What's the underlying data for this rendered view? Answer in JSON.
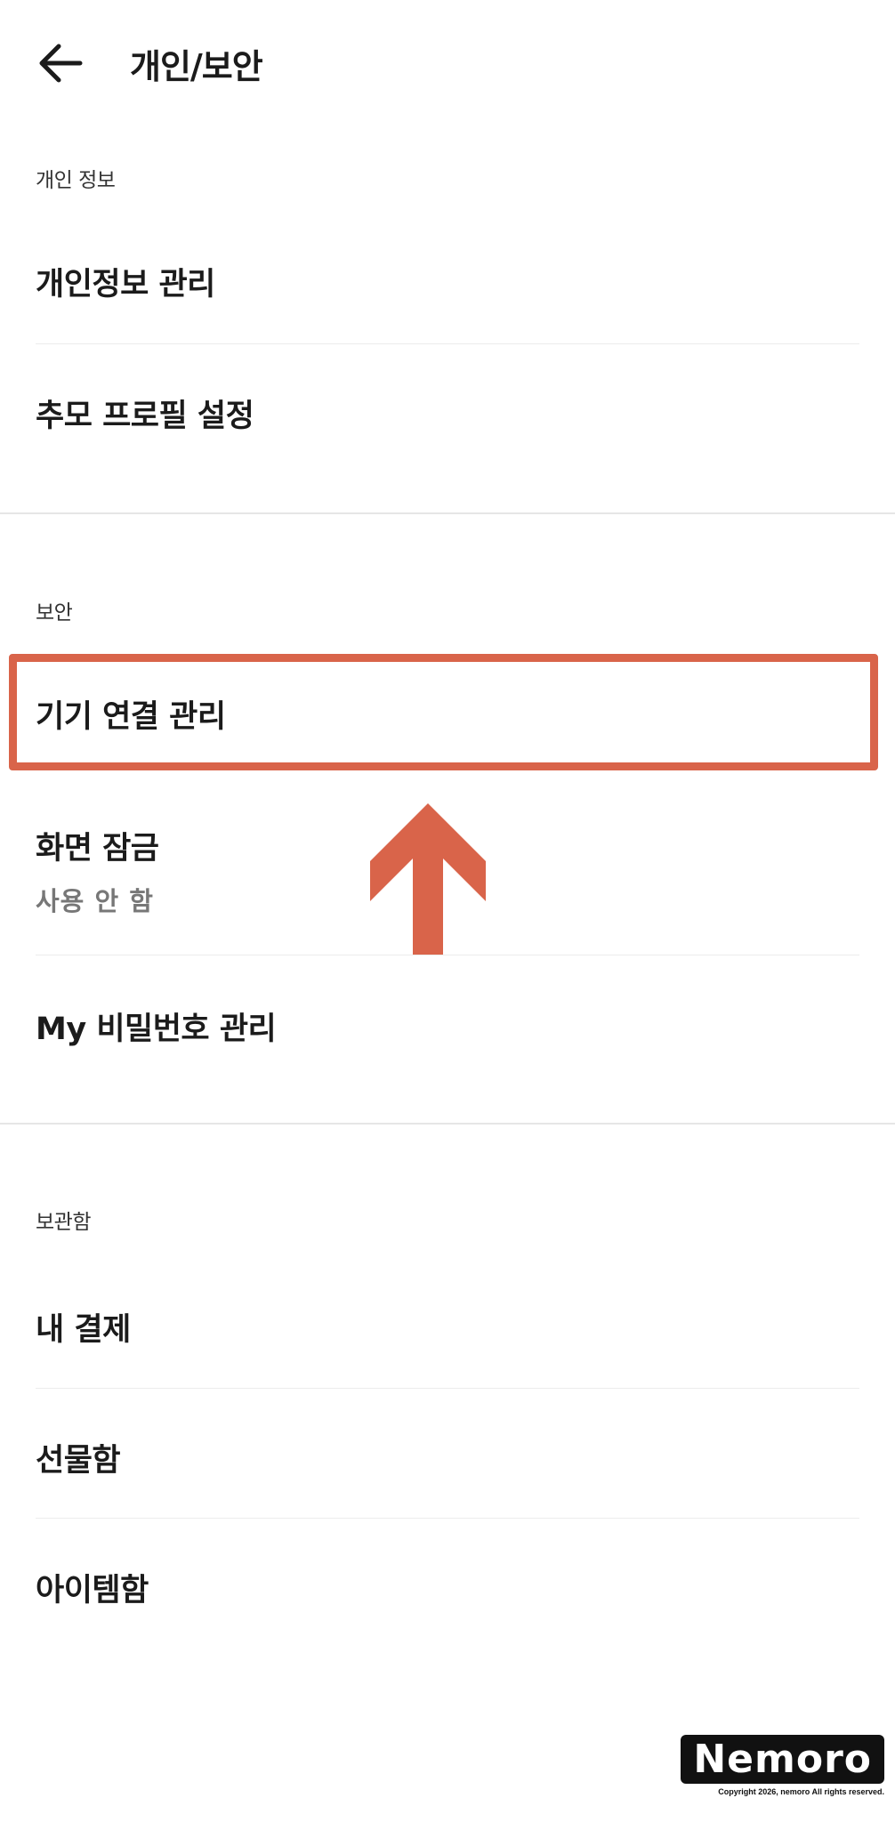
{
  "header": {
    "title": "개인/보안"
  },
  "sections": [
    {
      "title": "개인 정보",
      "items": [
        {
          "label": "개인정보 관리"
        },
        {
          "label": "추모 프로필 설정"
        }
      ]
    },
    {
      "title": "보안",
      "items": [
        {
          "label": "기기 연결 관리"
        },
        {
          "label": "화면 잠금",
          "sub": "사용 안 함"
        },
        {
          "label": "My 비밀번호 관리"
        }
      ]
    },
    {
      "title": "보관함",
      "items": [
        {
          "label": "내 결제"
        },
        {
          "label": "선물함"
        },
        {
          "label": "아이템함"
        }
      ]
    }
  ],
  "annotation": {
    "color": "#d9644a",
    "highlighted_item": "기기 연결 관리"
  },
  "watermark": {
    "logo": "Nemoro",
    "copyright": "Copyright 2026, nemoro All rights reserved."
  }
}
